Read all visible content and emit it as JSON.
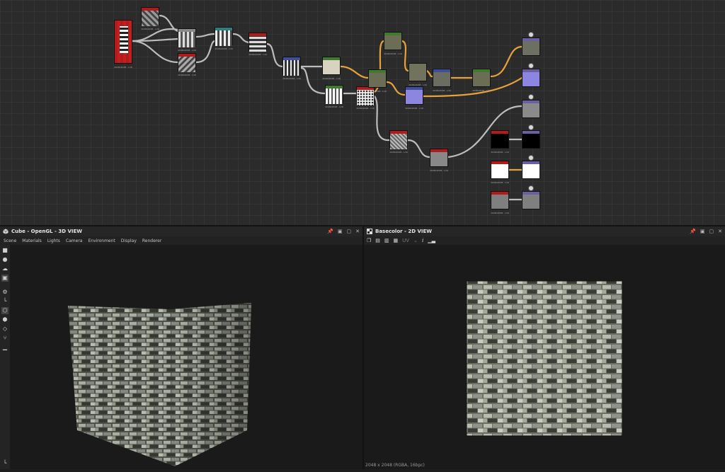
{
  "graph": {
    "node_caption": "2048x2048 - L16",
    "colors": {
      "red": "#b31b1b",
      "teal": "#2a7f80",
      "green": "#3f7a2e",
      "blue": "#3d4f9a",
      "purple": "#6a5fa0",
      "wire_white": "#bdbdbd",
      "wire_orange": "#e8a23b"
    },
    "output_badge_icon": "output-icon"
  },
  "panel3d": {
    "title": "Cube - OpenGL - 3D VIEW",
    "title_icon": "cube-icon",
    "menu": [
      "Scene",
      "Materials",
      "Lights",
      "Camera",
      "Environment",
      "Display",
      "Renderer"
    ],
    "controls": [
      "pin-icon",
      "float-icon",
      "maximize-icon",
      "close-icon"
    ],
    "tools": [
      "camera-icon",
      "light-icon",
      "environment-icon",
      "display-icon",
      "render-icon",
      "axis-icon",
      "cube-icon",
      "cube-outline-icon",
      "plane-icon",
      "sphere-icon",
      "chart-icon"
    ]
  },
  "panel2d": {
    "title": "Basecolor - 2D VIEW",
    "title_icon": "image-icon",
    "toolbar": [
      "copy-icon",
      "save-icon",
      "export-icon",
      "fit-icon",
      "UV",
      "info-icon",
      "histogram-icon"
    ],
    "status": "2048 x 2048 (RGBA, 16bpc)"
  },
  "texture": {
    "base": "#6b6e60",
    "brick_light": "#b8bdb2",
    "brick_mid": "#8f938a",
    "brick_dark": "#3a3c38",
    "mortar": "#55584d"
  }
}
